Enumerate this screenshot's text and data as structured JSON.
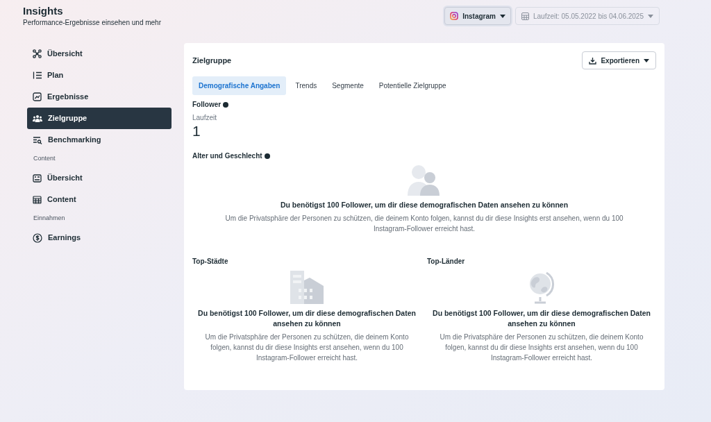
{
  "header": {
    "title": "Insights",
    "subtitle": "Performance-Ergebnisse einsehen und mehr"
  },
  "account_selector": {
    "label": "Instagram"
  },
  "date_range": {
    "label": "Laufzeit: 05.05.2022 bis 04.06.2025"
  },
  "sidebar": [
    {
      "kind": "item",
      "label": "Übersicht",
      "selected": false
    },
    {
      "kind": "item",
      "label": "Plan",
      "selected": false
    },
    {
      "kind": "item",
      "label": "Ergebnisse",
      "selected": false
    },
    {
      "kind": "item",
      "label": "Zielgruppe",
      "selected": true
    },
    {
      "kind": "item",
      "label": "Benchmarking",
      "selected": false
    },
    {
      "kind": "section",
      "label": "Content"
    },
    {
      "kind": "item",
      "label": "Übersicht",
      "selected": false
    },
    {
      "kind": "item",
      "label": "Content",
      "selected": false
    },
    {
      "kind": "section",
      "label": "Einnahmen"
    },
    {
      "kind": "item",
      "label": "Earnings",
      "selected": false
    }
  ],
  "card": {
    "title": "Zielgruppe",
    "export_button": "Exportieren",
    "tabs": [
      {
        "label": "Demografische Angaben",
        "selected": true
      },
      {
        "label": "Trends",
        "selected": false
      },
      {
        "label": "Segmente",
        "selected": false
      },
      {
        "label": "Potentielle Zielgruppe",
        "selected": false
      }
    ],
    "follower": {
      "title": "Follower",
      "period": "Laufzeit",
      "value": "1"
    },
    "sections": [
      {
        "title": "Alter und Geschlecht",
        "info": true,
        "message": "Du benötigst 100 Follower, um dir diese demografischen Daten ansehen zu können",
        "description": "Um die Privatsphäre der Personen zu schützen, die deinem Konto folgen, kannst du dir diese Insights erst ansehen, wenn du 100 Instagram-Follower erreicht hast."
      },
      {
        "title": "Top-Städte",
        "info": false,
        "message": "Du benötigst 100 Follower, um dir diese demografischen Daten ansehen zu können",
        "description": "Um die Privatsphäre der Personen zu schützen, die deinem Konto folgen, kannst du dir diese Insights erst ansehen, wenn du 100 Instagram-Follower erreicht hast."
      },
      {
        "title": "Top-Länder",
        "info": false,
        "message": "Du benötigst 100 Follower, um dir diese demografischen Daten ansehen zu können",
        "description": "Um die Privatsphäre der Personen zu schützen, die deinem Konto folgen, kannst du dir diese Insights erst ansehen, wenn du 100 Instagram-Follower erreicht hast."
      }
    ]
  }
}
